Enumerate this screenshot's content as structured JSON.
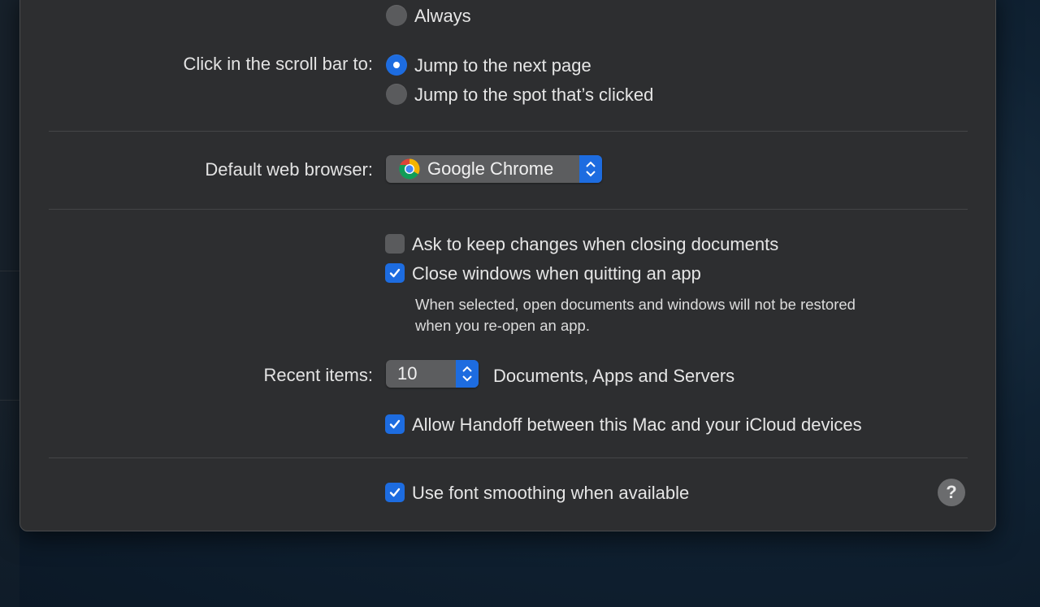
{
  "scroll_bars_section": {
    "always_label": "Always",
    "click_label": "Click in the scroll bar to:",
    "options": [
      {
        "label": "Jump to the next page",
        "selected": true
      },
      {
        "label": "Jump to the spot that’s clicked",
        "selected": false
      }
    ]
  },
  "browser_section": {
    "label": "Default web browser:",
    "value": "Google Chrome",
    "icon": "chrome-icon"
  },
  "documents_section": {
    "ask_keep_changes": {
      "label": "Ask to keep changes when closing documents",
      "checked": false
    },
    "close_windows": {
      "label": "Close windows when quitting an app",
      "checked": true
    },
    "note_line1": "When selected, open documents and windows will not be restored",
    "note_line2": "when you re-open an app."
  },
  "recent_items": {
    "label": "Recent items:",
    "value": "10",
    "suffix": "Documents, Apps and Servers"
  },
  "handoff": {
    "label": "Allow Handoff between this Mac and your iCloud devices",
    "checked": true
  },
  "font_smoothing": {
    "label": "Use font smoothing when available",
    "checked": true
  },
  "help_button": {
    "label": "?"
  },
  "colors": {
    "accent": "#1d6ce0",
    "window_bg": "#2d2e30"
  }
}
